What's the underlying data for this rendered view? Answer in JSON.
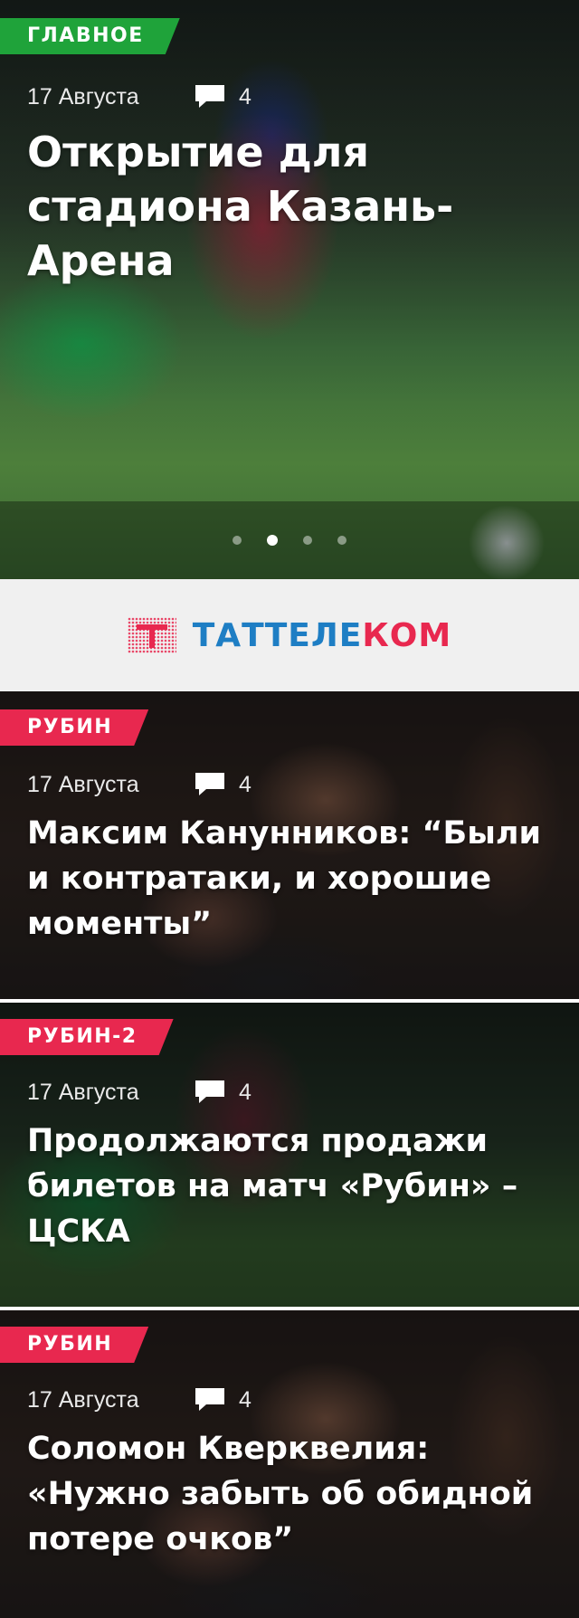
{
  "hero": {
    "tag": "ГЛАВНОЕ",
    "date": "17 Августа",
    "comments": "4",
    "title": "Открытие для стадиона Казань-Арена",
    "pager": {
      "count": 4,
      "active": 2
    }
  },
  "banner": {
    "brand_part1": "ТАТТЕЛЕ",
    "brand_part2": "КОМ"
  },
  "news": [
    {
      "tag": "РУБИН",
      "date": "17 Августа",
      "comments": "4",
      "title": "Максим Канунников: “Были и контратаки, и хорошие моменты”"
    },
    {
      "tag": "РУБИН-2",
      "date": "17 Августа",
      "comments": "4",
      "title": "Продолжаются продажи билетов на матч «Рубин» – ЦСКА"
    },
    {
      "tag": "РУБИН",
      "date": "17 Августа",
      "comments": "4",
      "title": "Соломон Кверквелия: «Нужно забыть об обидной потере очков”"
    }
  ],
  "colors": {
    "green_tag": "#1fa33a",
    "pink_tag": "#e8284f",
    "brand_blue": "#1e7ec4",
    "brand_red": "#e8284f"
  },
  "icons": [
    "comment-icon",
    "tattelecom-logo-mark"
  ]
}
